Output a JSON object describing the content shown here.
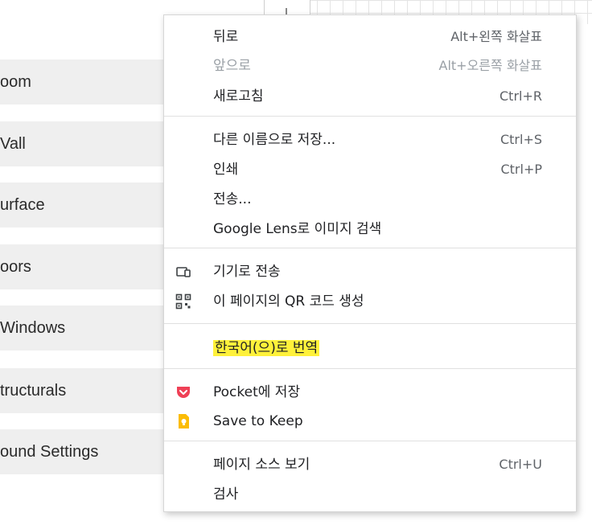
{
  "sidebar": {
    "items": [
      {
        "label": "oom"
      },
      {
        "label": "Vall"
      },
      {
        "label": "urface"
      },
      {
        "label": "oors"
      },
      {
        "label": "Windows"
      },
      {
        "label": "tructurals"
      },
      {
        "label": "ound Settings"
      }
    ]
  },
  "menu": {
    "back": {
      "label": "뒤로",
      "shortcut": "Alt+왼쪽 화살표"
    },
    "forward": {
      "label": "앞으로",
      "shortcut": "Alt+오른쪽 화살표"
    },
    "reload": {
      "label": "새로고침",
      "shortcut": "Ctrl+R"
    },
    "save_as": {
      "label": "다른 이름으로 저장...",
      "shortcut": "Ctrl+S"
    },
    "print": {
      "label": "인쇄",
      "shortcut": "Ctrl+P"
    },
    "cast": {
      "label": "전송..."
    },
    "lens": {
      "label": "Google Lens로 이미지 검색"
    },
    "send_to_device": {
      "label": "기기로 전송",
      "icon": "device-icon"
    },
    "qr_code": {
      "label": "이 페이지의 QR 코드 생성",
      "icon": "qr-code-icon"
    },
    "translate": {
      "label": "한국어(으)로 번역"
    },
    "pocket": {
      "label": "Pocket에 저장",
      "icon": "pocket-icon",
      "color": "#ef4056"
    },
    "keep": {
      "label": "Save to Keep",
      "icon": "keep-icon",
      "color": "#fbbc04"
    },
    "view_source": {
      "label": "페이지 소스 보기",
      "shortcut": "Ctrl+U"
    },
    "inspect": {
      "label": "검사"
    }
  }
}
